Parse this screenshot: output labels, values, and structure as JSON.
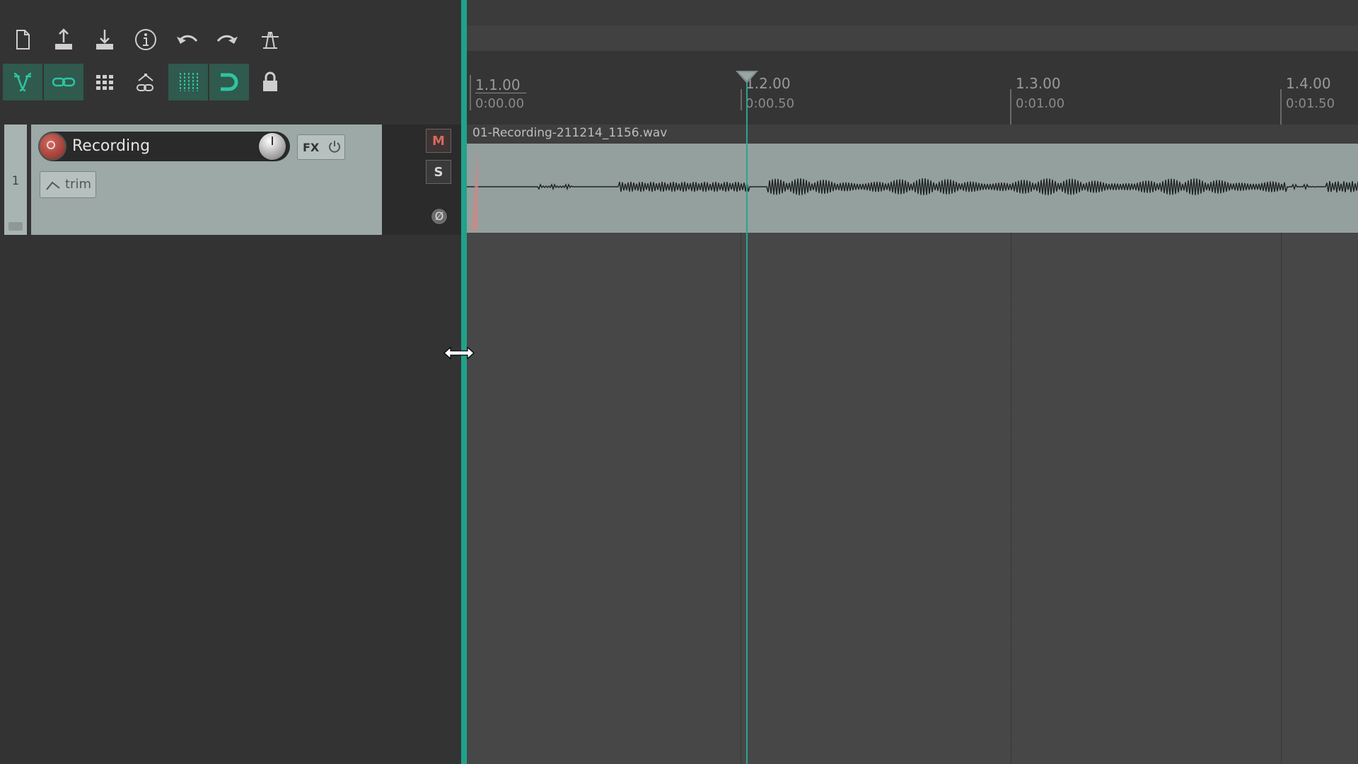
{
  "toolbar": {
    "row1": [
      "new-project-icon",
      "open-project-icon",
      "save-project-icon",
      "project-info-icon",
      "undo-icon",
      "redo-icon",
      "metronome-icon"
    ],
    "row2": [
      "ripple-edit-icon",
      "item-grouping-icon",
      "grid-icon",
      "envelope-link-icon",
      "snap-grid-icon",
      "snap-magnet-icon",
      "lock-icon"
    ]
  },
  "track": {
    "number": "1",
    "name": "Recording",
    "fx_label": "FX",
    "trim_label": "trim",
    "mute_label": "M",
    "solo_label": "S",
    "phase_label": "Ø"
  },
  "ruler": {
    "marks": [
      {
        "bar": "1.1.00",
        "time": "0:00.00"
      },
      {
        "bar": "1.2.00",
        "time": "0:00.50"
      },
      {
        "bar": "1.3.00",
        "time": "0:01.00"
      },
      {
        "bar": "1.4.00",
        "time": "0:01.50"
      }
    ]
  },
  "item": {
    "name": "01-Recording-211214_1156.wav"
  },
  "colors": {
    "accent": "#21a28a",
    "item_body": "#93a09e",
    "track_header": "#9ca9a7",
    "mute": "#d46a5e"
  },
  "playhead": {
    "time": "0:00.50"
  }
}
